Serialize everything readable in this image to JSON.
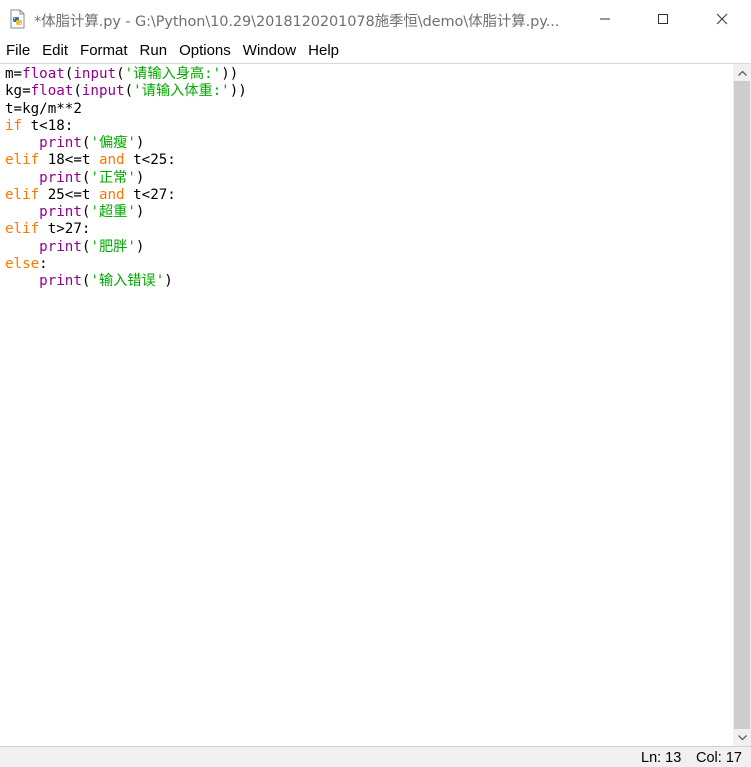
{
  "window": {
    "title": "*体脂计算.py - G:\\Python\\10.29\\2018120201078施季恒\\demo\\体脂计算.py..."
  },
  "menu": [
    "File",
    "Edit",
    "Format",
    "Run",
    "Options",
    "Window",
    "Help"
  ],
  "code_lines": [
    [
      {
        "t": "m=",
        "c": "n"
      },
      {
        "t": "float",
        "c": "bi"
      },
      {
        "t": "(",
        "c": "n"
      },
      {
        "t": "input",
        "c": "bi"
      },
      {
        "t": "(",
        "c": "n"
      },
      {
        "t": "'请输入身高:'",
        "c": "str"
      },
      {
        "t": "))",
        "c": "n"
      }
    ],
    [
      {
        "t": "kg=",
        "c": "n"
      },
      {
        "t": "float",
        "c": "bi"
      },
      {
        "t": "(",
        "c": "n"
      },
      {
        "t": "input",
        "c": "bi"
      },
      {
        "t": "(",
        "c": "n"
      },
      {
        "t": "'请输入体重:'",
        "c": "str"
      },
      {
        "t": "))",
        "c": "n"
      }
    ],
    [
      {
        "t": "t=kg/m**2",
        "c": "n"
      }
    ],
    [
      {
        "t": "if",
        "c": "kw"
      },
      {
        "t": " t<18:",
        "c": "n"
      }
    ],
    [
      {
        "t": "    ",
        "c": "n"
      },
      {
        "t": "print",
        "c": "bi"
      },
      {
        "t": "(",
        "c": "n"
      },
      {
        "t": "'偏瘦'",
        "c": "str"
      },
      {
        "t": ")",
        "c": "n"
      }
    ],
    [
      {
        "t": "elif",
        "c": "kw"
      },
      {
        "t": " 18<=t ",
        "c": "n"
      },
      {
        "t": "and",
        "c": "kw"
      },
      {
        "t": " t<25:",
        "c": "n"
      }
    ],
    [
      {
        "t": "    ",
        "c": "n"
      },
      {
        "t": "print",
        "c": "bi"
      },
      {
        "t": "(",
        "c": "n"
      },
      {
        "t": "'正常'",
        "c": "str"
      },
      {
        "t": ")",
        "c": "n"
      }
    ],
    [
      {
        "t": "elif",
        "c": "kw"
      },
      {
        "t": " 25<=t ",
        "c": "n"
      },
      {
        "t": "and",
        "c": "kw"
      },
      {
        "t": " t<27:",
        "c": "n"
      }
    ],
    [
      {
        "t": "    ",
        "c": "n"
      },
      {
        "t": "print",
        "c": "bi"
      },
      {
        "t": "(",
        "c": "n"
      },
      {
        "t": "'超重'",
        "c": "str"
      },
      {
        "t": ")",
        "c": "n"
      }
    ],
    [
      {
        "t": "elif",
        "c": "kw"
      },
      {
        "t": " t>27:",
        "c": "n"
      }
    ],
    [
      {
        "t": "    ",
        "c": "n"
      },
      {
        "t": "print",
        "c": "bi"
      },
      {
        "t": "(",
        "c": "n"
      },
      {
        "t": "'肥胖'",
        "c": "str"
      },
      {
        "t": ")",
        "c": "n"
      }
    ],
    [
      {
        "t": "else",
        "c": "kw"
      },
      {
        "t": ":",
        "c": "n"
      }
    ],
    [
      {
        "t": "    ",
        "c": "n"
      },
      {
        "t": "print",
        "c": "bi"
      },
      {
        "t": "(",
        "c": "n"
      },
      {
        "t": "'输入错误'",
        "c": "str"
      },
      {
        "t": ")",
        "c": "n"
      }
    ]
  ],
  "status": {
    "line": "Ln: 13",
    "col": "Col: 17"
  },
  "colors": {
    "keyword": "#ff7700",
    "builtin": "#900090",
    "string": "#00aa00"
  }
}
